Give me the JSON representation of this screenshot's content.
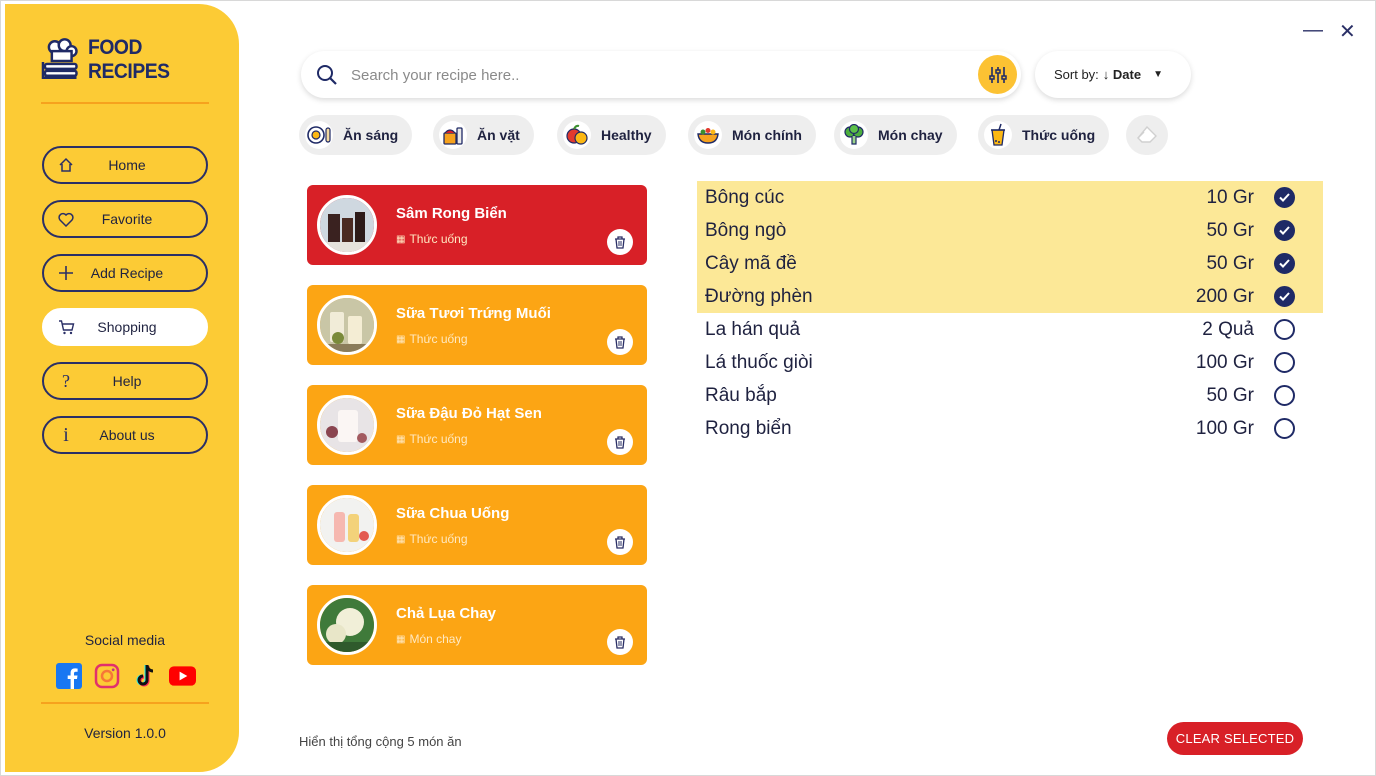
{
  "app": {
    "name": "FOOD RECIPES",
    "version": "Version 1.0.0"
  },
  "window": {
    "minimize": "—",
    "close": "✕"
  },
  "sidebar": {
    "items": [
      {
        "label": "Home",
        "icon": "home-icon"
      },
      {
        "label": "Favorite",
        "icon": "heart-icon"
      },
      {
        "label": "Add Recipe",
        "icon": "plus-icon"
      },
      {
        "label": "Shopping",
        "icon": "cart-icon",
        "active": true
      },
      {
        "label": "Help",
        "icon": "question-icon"
      },
      {
        "label": "About us",
        "icon": "info-icon"
      }
    ],
    "social_title": "Social media",
    "social": [
      "facebook-icon",
      "instagram-icon",
      "tiktok-icon",
      "youtube-icon"
    ]
  },
  "search": {
    "placeholder": "Search your recipe here.."
  },
  "sort": {
    "label": "Sort by:",
    "value": "↓ Date"
  },
  "categories": [
    "Ăn sáng",
    "Ăn vặt",
    "Healthy",
    "Món chính",
    "Món chay",
    "Thức uống"
  ],
  "recipes": [
    {
      "title": "Sâm Rong Biển",
      "category": "Thức uống",
      "selected": true
    },
    {
      "title": "Sữa Tươi Trứng Muối",
      "category": "Thức uống"
    },
    {
      "title": "Sữa Đậu Đỏ Hạt Sen",
      "category": "Thức uống"
    },
    {
      "title": "Sữa Chua Uống",
      "category": "Thức uống"
    },
    {
      "title": "Chả Lụa Chay",
      "category": "Món chay"
    }
  ],
  "ingredients": [
    {
      "name": "Bông cúc",
      "qty": "10 Gr",
      "checked": true
    },
    {
      "name": "Bông ngò",
      "qty": "50 Gr",
      "checked": true
    },
    {
      "name": "Cây mã đề",
      "qty": "50 Gr",
      "checked": true
    },
    {
      "name": "Đường phèn",
      "qty": "200 Gr",
      "checked": true
    },
    {
      "name": "La hán quả",
      "qty": "2 Quả",
      "checked": false
    },
    {
      "name": "Lá thuốc giòi",
      "qty": "100 Gr",
      "checked": false
    },
    {
      "name": "Râu bắp",
      "qty": "50 Gr",
      "checked": false
    },
    {
      "name": "Rong biển",
      "qty": "100 Gr",
      "checked": false
    }
  ],
  "footer": {
    "total": "Hiển thị tổng cộng 5 món ăn",
    "clear_button": "CLEAR SELECTED"
  },
  "colors": {
    "sidebar": "#fccb35",
    "card": "#fca514",
    "card_selected": "#d82027",
    "checked_row": "#fce897",
    "navy": "#1f2a66"
  }
}
